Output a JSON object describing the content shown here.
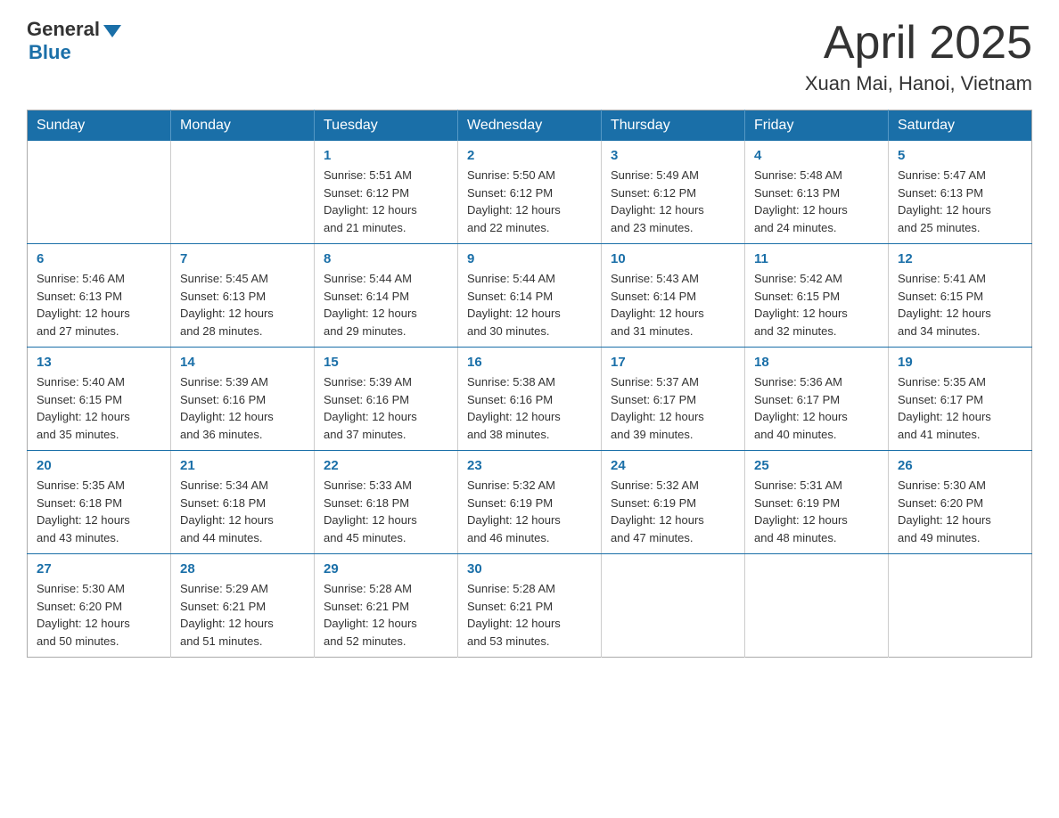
{
  "header": {
    "logo_general": "General",
    "logo_blue": "Blue",
    "month_title": "April 2025",
    "location": "Xuan Mai, Hanoi, Vietnam"
  },
  "days_of_week": [
    "Sunday",
    "Monday",
    "Tuesday",
    "Wednesday",
    "Thursday",
    "Friday",
    "Saturday"
  ],
  "weeks": [
    [
      {
        "day": "",
        "info": ""
      },
      {
        "day": "",
        "info": ""
      },
      {
        "day": "1",
        "info": "Sunrise: 5:51 AM\nSunset: 6:12 PM\nDaylight: 12 hours\nand 21 minutes."
      },
      {
        "day": "2",
        "info": "Sunrise: 5:50 AM\nSunset: 6:12 PM\nDaylight: 12 hours\nand 22 minutes."
      },
      {
        "day": "3",
        "info": "Sunrise: 5:49 AM\nSunset: 6:12 PM\nDaylight: 12 hours\nand 23 minutes."
      },
      {
        "day": "4",
        "info": "Sunrise: 5:48 AM\nSunset: 6:13 PM\nDaylight: 12 hours\nand 24 minutes."
      },
      {
        "day": "5",
        "info": "Sunrise: 5:47 AM\nSunset: 6:13 PM\nDaylight: 12 hours\nand 25 minutes."
      }
    ],
    [
      {
        "day": "6",
        "info": "Sunrise: 5:46 AM\nSunset: 6:13 PM\nDaylight: 12 hours\nand 27 minutes."
      },
      {
        "day": "7",
        "info": "Sunrise: 5:45 AM\nSunset: 6:13 PM\nDaylight: 12 hours\nand 28 minutes."
      },
      {
        "day": "8",
        "info": "Sunrise: 5:44 AM\nSunset: 6:14 PM\nDaylight: 12 hours\nand 29 minutes."
      },
      {
        "day": "9",
        "info": "Sunrise: 5:44 AM\nSunset: 6:14 PM\nDaylight: 12 hours\nand 30 minutes."
      },
      {
        "day": "10",
        "info": "Sunrise: 5:43 AM\nSunset: 6:14 PM\nDaylight: 12 hours\nand 31 minutes."
      },
      {
        "day": "11",
        "info": "Sunrise: 5:42 AM\nSunset: 6:15 PM\nDaylight: 12 hours\nand 32 minutes."
      },
      {
        "day": "12",
        "info": "Sunrise: 5:41 AM\nSunset: 6:15 PM\nDaylight: 12 hours\nand 34 minutes."
      }
    ],
    [
      {
        "day": "13",
        "info": "Sunrise: 5:40 AM\nSunset: 6:15 PM\nDaylight: 12 hours\nand 35 minutes."
      },
      {
        "day": "14",
        "info": "Sunrise: 5:39 AM\nSunset: 6:16 PM\nDaylight: 12 hours\nand 36 minutes."
      },
      {
        "day": "15",
        "info": "Sunrise: 5:39 AM\nSunset: 6:16 PM\nDaylight: 12 hours\nand 37 minutes."
      },
      {
        "day": "16",
        "info": "Sunrise: 5:38 AM\nSunset: 6:16 PM\nDaylight: 12 hours\nand 38 minutes."
      },
      {
        "day": "17",
        "info": "Sunrise: 5:37 AM\nSunset: 6:17 PM\nDaylight: 12 hours\nand 39 minutes."
      },
      {
        "day": "18",
        "info": "Sunrise: 5:36 AM\nSunset: 6:17 PM\nDaylight: 12 hours\nand 40 minutes."
      },
      {
        "day": "19",
        "info": "Sunrise: 5:35 AM\nSunset: 6:17 PM\nDaylight: 12 hours\nand 41 minutes."
      }
    ],
    [
      {
        "day": "20",
        "info": "Sunrise: 5:35 AM\nSunset: 6:18 PM\nDaylight: 12 hours\nand 43 minutes."
      },
      {
        "day": "21",
        "info": "Sunrise: 5:34 AM\nSunset: 6:18 PM\nDaylight: 12 hours\nand 44 minutes."
      },
      {
        "day": "22",
        "info": "Sunrise: 5:33 AM\nSunset: 6:18 PM\nDaylight: 12 hours\nand 45 minutes."
      },
      {
        "day": "23",
        "info": "Sunrise: 5:32 AM\nSunset: 6:19 PM\nDaylight: 12 hours\nand 46 minutes."
      },
      {
        "day": "24",
        "info": "Sunrise: 5:32 AM\nSunset: 6:19 PM\nDaylight: 12 hours\nand 47 minutes."
      },
      {
        "day": "25",
        "info": "Sunrise: 5:31 AM\nSunset: 6:19 PM\nDaylight: 12 hours\nand 48 minutes."
      },
      {
        "day": "26",
        "info": "Sunrise: 5:30 AM\nSunset: 6:20 PM\nDaylight: 12 hours\nand 49 minutes."
      }
    ],
    [
      {
        "day": "27",
        "info": "Sunrise: 5:30 AM\nSunset: 6:20 PM\nDaylight: 12 hours\nand 50 minutes."
      },
      {
        "day": "28",
        "info": "Sunrise: 5:29 AM\nSunset: 6:21 PM\nDaylight: 12 hours\nand 51 minutes."
      },
      {
        "day": "29",
        "info": "Sunrise: 5:28 AM\nSunset: 6:21 PM\nDaylight: 12 hours\nand 52 minutes."
      },
      {
        "day": "30",
        "info": "Sunrise: 5:28 AM\nSunset: 6:21 PM\nDaylight: 12 hours\nand 53 minutes."
      },
      {
        "day": "",
        "info": ""
      },
      {
        "day": "",
        "info": ""
      },
      {
        "day": "",
        "info": ""
      }
    ]
  ]
}
